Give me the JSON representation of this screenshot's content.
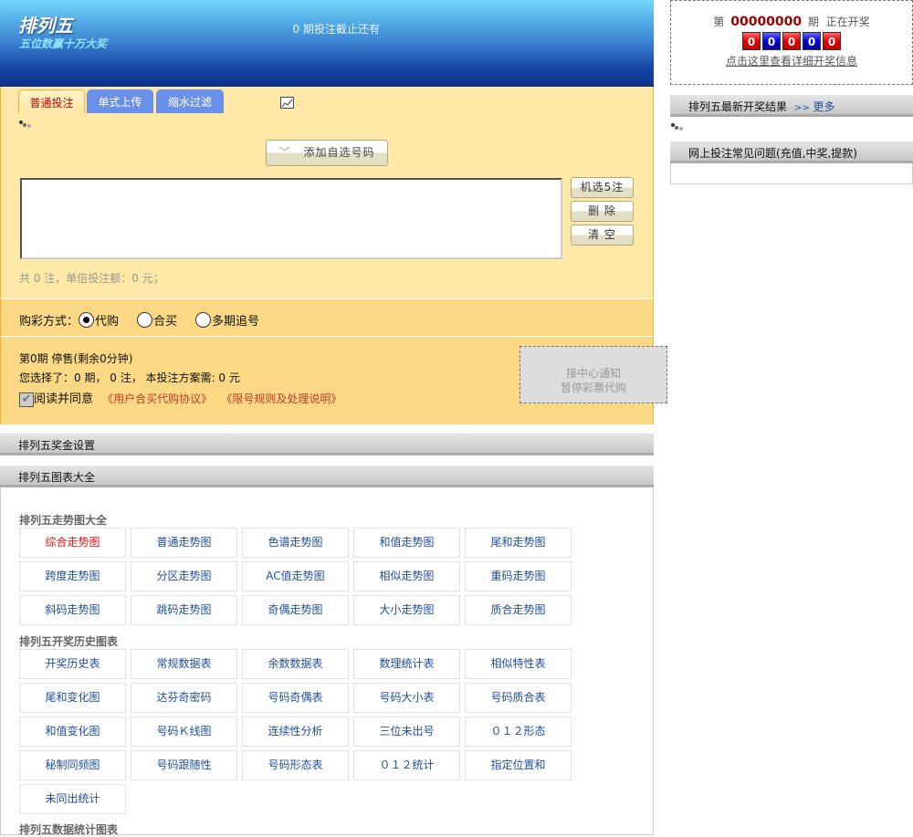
{
  "header": {
    "logo": "排列五",
    "slogan": "五位数赢十万大奖",
    "deadline": "0 期投注截止还有"
  },
  "tabs": [
    {
      "label": "普通投注",
      "active": true
    },
    {
      "label": "单式上传"
    },
    {
      "label": "缩水过滤"
    }
  ],
  "bet": {
    "add_button": "添加自选号码",
    "random_button": "机选5注",
    "delete_button": "删 除",
    "clear_button": "清 空",
    "summary": "共 0 注，单倍投注额：0 元；"
  },
  "purchase": {
    "label": "购彩方式：",
    "options": [
      "代购",
      "合买",
      "多期追号"
    ],
    "selected": "代购"
  },
  "info": {
    "status": "第0期 停售(剩余0分钟)",
    "selection": "您选择了：0 期， 0 注， 本投注方案需: 0 元",
    "agree_label": "阅读并同意",
    "agree_checked": true,
    "link1": "《用户合买代购协议》",
    "link2": "《限号规则及处理说明》",
    "notice_line1": "接中心通知",
    "notice_line2": "暂停彩票代购"
  },
  "sections": {
    "prize": "排列五奖金设置",
    "charts": "排列五图表大全"
  },
  "trend": {
    "title": "排列五走势图大全",
    "items": [
      "综合走势图",
      "普通走势图",
      "色谱走势图",
      "和值走势图",
      "尾和走势图",
      "跨度走势图",
      "分区走势图",
      "AC值走势图",
      "相似走势图",
      "重码走势图",
      "斜码走势图",
      "跳码走势图",
      "奇偶走势图",
      "大小走势图",
      "质合走势图"
    ]
  },
  "history": {
    "title": "排列五开奖历史图表",
    "items": [
      "开奖历史表",
      "常规数据表",
      "余数数据表",
      "数理统计表",
      "相似特性表",
      "尾和变化图",
      "达芬奇密码",
      "号码奇偶表",
      "号码大小表",
      "号码质合表",
      "和值变化图",
      "号码Ｋ线图",
      "连续性分析",
      "三位未出号",
      "０１２形态",
      "秘制同频图",
      "号码跟随性",
      "号码形态表",
      "０１２统计",
      "指定位置和",
      "未同出统计"
    ]
  },
  "stats": {
    "title": "排列五数据统计图表"
  },
  "draw": {
    "prefix": "第",
    "issue": "00000000",
    "suffix": "期  正在开奖",
    "balls": [
      "0",
      "0",
      "0",
      "0",
      "0"
    ],
    "detail_link": "点击这里查看详细开奖信息"
  },
  "sidebar": {
    "latest_title": "排列五最新开奖结果",
    "more_arrows": ">>",
    "more": "更多",
    "faq_title": "网上投注常见问题(充值,中奖,提款)"
  },
  "colors": {
    "highlight": "#ee1111",
    "link": "#1f4fa0",
    "issue": "#9b0000"
  }
}
